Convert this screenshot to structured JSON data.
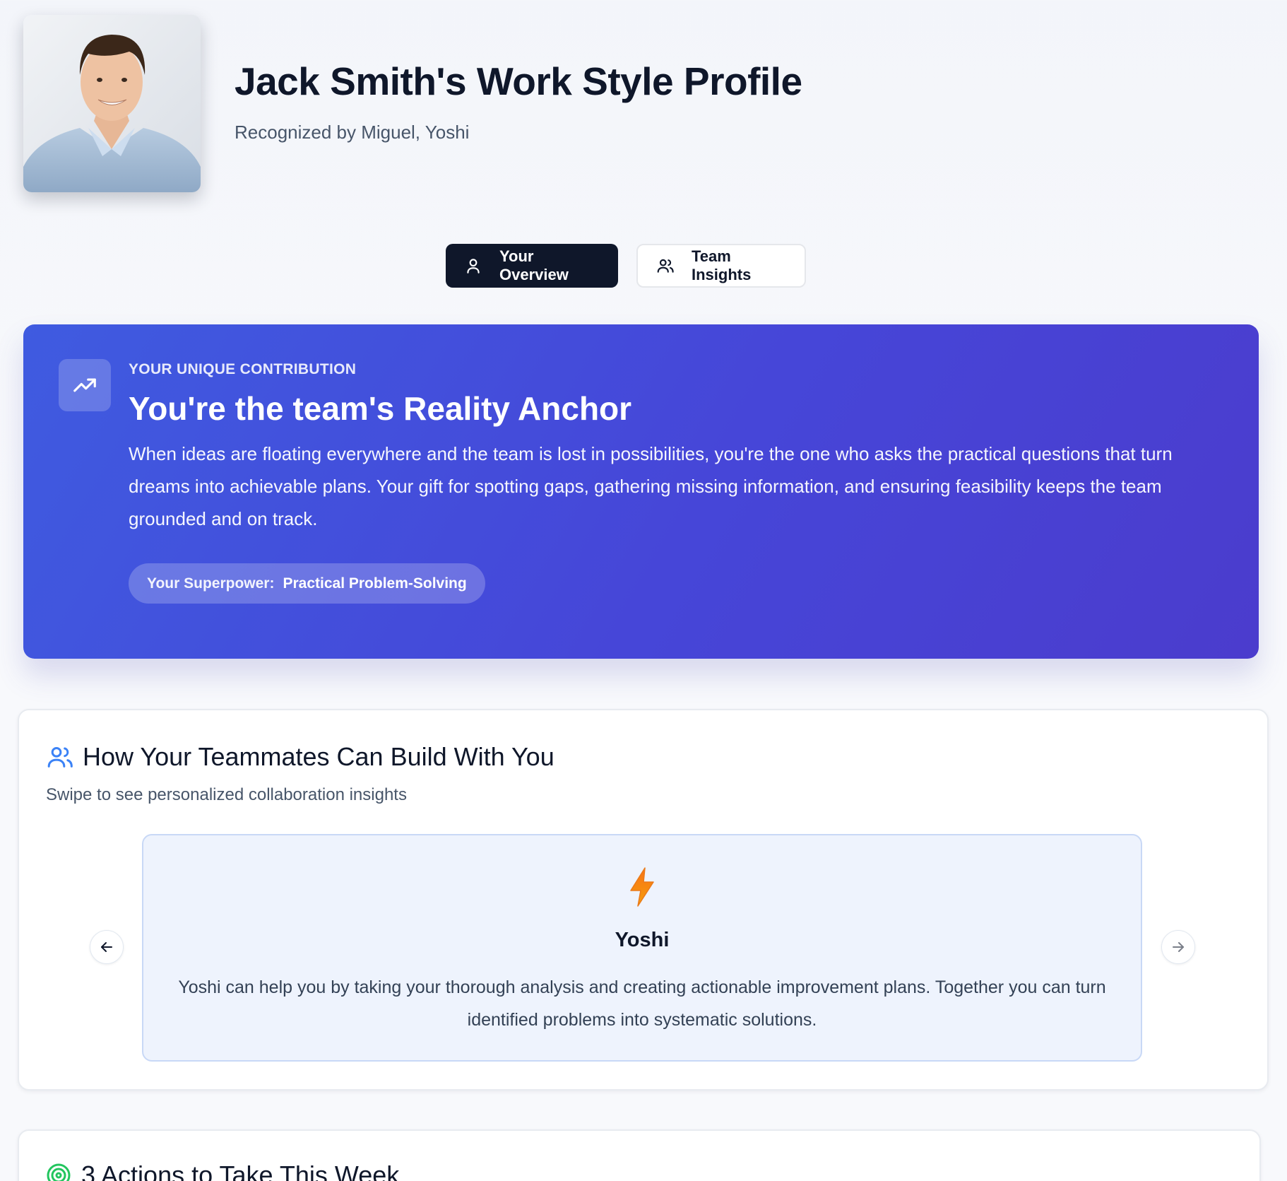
{
  "header": {
    "title": "Jack Smith's Work Style Profile",
    "subtitle": "Recognized by Miguel, Yoshi",
    "avatar_icon": "profile-photo"
  },
  "tabs": [
    {
      "label": "Your Overview",
      "icon": "user-icon",
      "active": true
    },
    {
      "label": "Team Insights",
      "icon": "users-icon",
      "active": false
    }
  ],
  "hero": {
    "icon": "trending-up-icon",
    "eyebrow": "YOUR UNIQUE CONTRIBUTION",
    "title": "You're the team's Reality Anchor",
    "text": "When ideas are floating everywhere and the team is lost in possibilities, you're the one who asks the practical questions that turn dreams into achievable plans. Your gift for spotting gaps, gathering missing information, and ensuring feasibility keeps the team grounded and on track.",
    "superpower_label": "Your Superpower:",
    "superpower_value": "Practical Problem-Solving"
  },
  "teammates": {
    "icon": "users-icon",
    "title": "How Your Teammates Can Build With You",
    "subtitle": "Swipe to see personalized collaboration insights",
    "slide": {
      "icon": "lightning-bolt-icon",
      "name": "Yoshi",
      "text": "Yoshi can help you by taking your thorough analysis and creating actionable improvement plans. Together you can turn identified problems into systematic solutions."
    }
  },
  "actions": {
    "icon": "target-icon",
    "title": "3 Actions to Take This Week"
  },
  "colors": {
    "hero_start": "#3f5be0",
    "hero_end": "#4b3ccd",
    "tab_active": "#0f172a",
    "accent_blue": "#3b82f6",
    "accent_green": "#22c55e"
  }
}
